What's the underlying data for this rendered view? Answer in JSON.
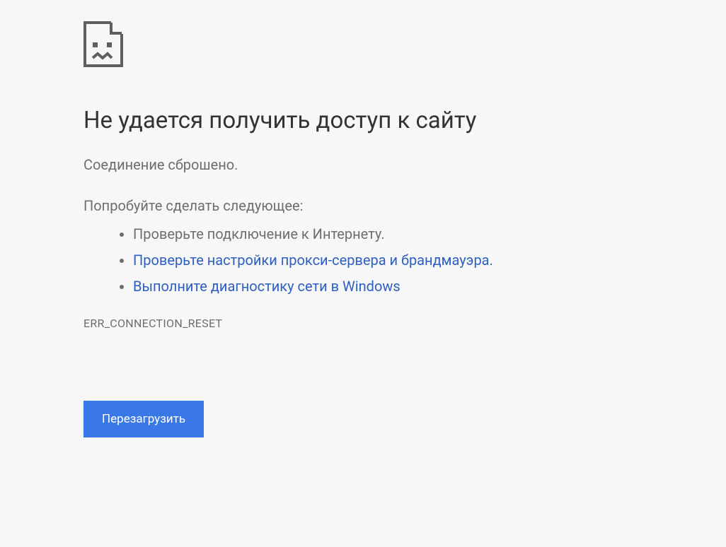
{
  "error": {
    "title": "Не удается получить доступ к сайту",
    "subtitle": "Соединение сброшено.",
    "suggestions_intro": "Попробуйте сделать следующее:",
    "suggestions": {
      "item1": "Проверьте подключение к Интернету.",
      "item2": "Проверьте настройки прокси-сервера и брандмауэра.",
      "item3": "Выполните диагностику сети в Windows"
    },
    "error_code": "ERR_CONNECTION_RESET",
    "reload_button": "Перезагрузить"
  }
}
